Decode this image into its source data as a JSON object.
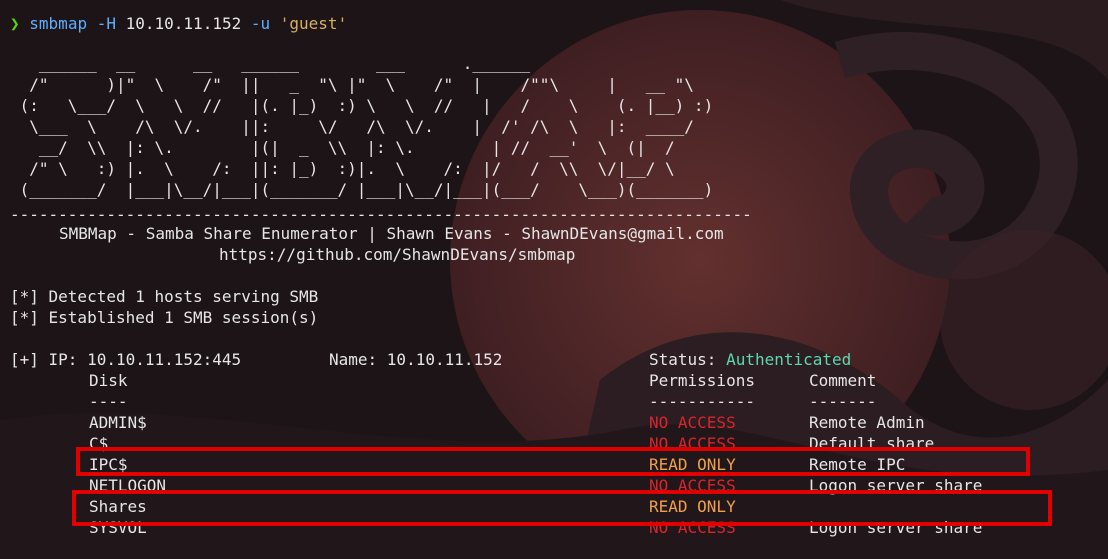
{
  "prompt": {
    "symbol": "❯",
    "command": "smbmap",
    "flag_host": "-H",
    "host": "10.10.11.152",
    "flag_user": "-u",
    "user": "'guest'"
  },
  "banner": {
    "ascii_art": "   ______  __      __   ______        ___      .______    \n  /\"      )|\"  \\    /\"  ||   _  \"\\ |\"  \\    /\"  |    /\"\"\\     |   __ \"\\ \n (:   \\___/  \\   \\  //   |(. |_)  :) \\   \\  //   |   /    \\    (. |__) :)\n  \\___  \\    /\\  \\/.    ||:     \\/   /\\  \\/.    |  /' /\\  \\   |:  ____/ \n   __/  \\\\  |: \\.        |(|  _  \\\\  |: \\.        | //  __'  \\  (|  /     \n  /\" \\   :) |.  \\    /:  ||: |_)  :)|.  \\    /:  |/   /  \\\\  \\/|__/ \\    \n (_______/  |___|\\__/|___|(_______/ |___|\\__/|___|(___/    \\___)(_______)   ",
    "divider": "-----------------------------------------------------------------------------",
    "tagline": "SMBMap - Samba Share Enumerator | Shawn Evans - ShawnDEvans@gmail.com",
    "url": "https://github.com/ShawnDEvans/smbmap"
  },
  "status_lines": [
    "[*] Detected 1 hosts serving SMB",
    "[*] Established 1 SMB session(s)"
  ],
  "host_line": {
    "prefix": "[+] IP: 10.10.11.152:445",
    "name": "Name: 10.10.11.152",
    "status_label": "Status: ",
    "status_value": "Authenticated"
  },
  "table": {
    "headers": {
      "disk": "Disk",
      "permissions": "Permissions",
      "comment": "Comment"
    },
    "separators": {
      "disk": "----",
      "permissions": "-----------",
      "comment": "-------"
    },
    "rows": [
      {
        "disk": "ADMIN$",
        "permissions": "NO ACCESS",
        "comment": "Remote Admin"
      },
      {
        "disk": "C$",
        "permissions": "NO ACCESS",
        "comment": "Default share"
      },
      {
        "disk": "IPC$",
        "permissions": "READ ONLY",
        "comment": "Remote IPC"
      },
      {
        "disk": "NETLOGON",
        "permissions": "NO ACCESS",
        "comment": "Logon server share"
      },
      {
        "disk": "Shares",
        "permissions": "READ ONLY",
        "comment": ""
      },
      {
        "disk": "SYSVOL",
        "permissions": "NO ACCESS",
        "comment": "Logon server share"
      }
    ]
  },
  "colors": {
    "no_access": "#d7262a",
    "read_only": "#f0a04b",
    "authenticated": "#5fd7af",
    "highlight_box": "#e00000"
  }
}
